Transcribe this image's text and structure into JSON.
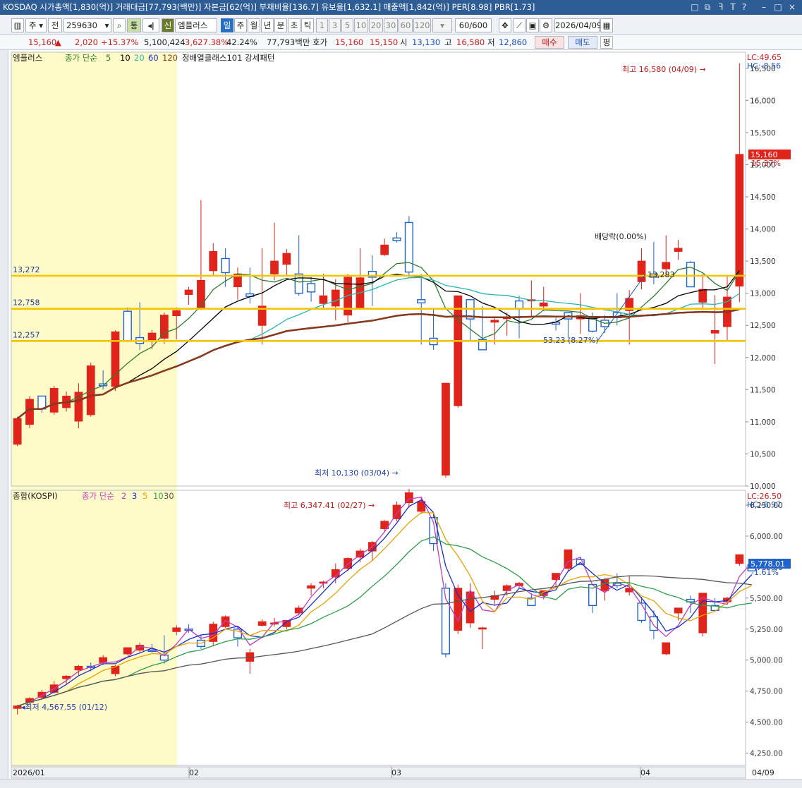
{
  "titlebar": {
    "text": "KOSDAQ 시가총액[1,830(억)] 거래대금[77,793(백만)] 자본금[62(억)] 부채비율[136.7] 유보율[1,632.1] 매출액[1,842(억)] PER[8.98] PBR[1.73]",
    "controls": [
      "□",
      "⧉",
      "ꟻ",
      "T",
      "?",
      "–",
      "□",
      "×"
    ]
  },
  "toolbar": {
    "market": "주",
    "prev": "전",
    "code": "259630",
    "tong": "통",
    "sin": "신",
    "name": "엠플러스",
    "periods": [
      "일",
      "주",
      "월",
      "년",
      "분",
      "초",
      "틱"
    ],
    "ticks": [
      "1",
      "3",
      "5",
      "10",
      "20",
      "30",
      "60",
      "120"
    ],
    "count": "60/600",
    "date": "2026/04/09"
  },
  "quote": {
    "price": "15,160",
    "up_arrow": "▲",
    "change": "2,020",
    "change_pct": "+15.37%",
    "volume": "5,100,424",
    "vol_ratio": "3,627.38%",
    "turnover": "42.24%",
    "amount": "77,793백만",
    "hoga_label": "호가",
    "ask": "15,160",
    "bid": "15,150",
    "open_label": "시",
    "open": "13,130",
    "high_label": "고",
    "high": "16,580",
    "low_label": "저",
    "low": "12,860",
    "buy": "매수",
    "sell": "매도",
    "flat": "평"
  },
  "upper_pane": {
    "legend_name": "엠플러스",
    "legend_ma": "종가 단순",
    "ma_periods": [
      "5",
      "10",
      "20",
      "60",
      "120"
    ],
    "ma_colors": [
      "#2e7d32",
      "#000000",
      "#26b5b5",
      "#1a2fd0",
      "#8b3a14"
    ],
    "pattern_label": "정배열클래스101 강세패턴",
    "lc": "LC:49.65",
    "hc": "HC:-8.56",
    "price_ticks": [
      "16,500",
      "16,000",
      "15,500",
      "15,000",
      "14,500",
      "14,000",
      "13,500",
      "13,000",
      "12,500",
      "12,000",
      "11,500",
      "11,000",
      "10,500",
      "10,000"
    ],
    "hlines": [
      "13,272",
      "12,758",
      "12,257"
    ],
    "current_price": "15,160",
    "current_pct": "15.37%",
    "high_note": "최고 16,580 (04/09)",
    "low_note": "최저 10,130 (03/04)",
    "dividend_note": "배당락(0.00%)",
    "measure_top": "13,283",
    "measure_note": "53.23 (8.27%)"
  },
  "lower_pane": {
    "legend_name": "종합(KOSPI)",
    "legend_ma": "종가 단순",
    "ma_periods": [
      "2",
      "3",
      "5",
      "10",
      "30"
    ],
    "ma_colors": [
      "#c23bc2",
      "#1a2fd0",
      "#e8a300",
      "#2e9e4e",
      "#555555"
    ],
    "lc": "LC:26.50",
    "hc": "HC:-8.97",
    "price_ticks": [
      "6,250.00",
      "6,000.00",
      "5,750.00",
      "5,500.00",
      "5,250.00",
      "5,000.00",
      "4,750.00",
      "4,500.00",
      "4,250.00"
    ],
    "current_price": "5,778.01",
    "current_pct": "-1.61%",
    "high_note": "최고 6,347.41 (02/27)",
    "low_note": "최저 4,567.55 (01/12)"
  },
  "x_axis": [
    "2026/01",
    "02",
    "03",
    "04"
  ],
  "x_axis_right": "04/09",
  "colors": {
    "up": "#e0241b",
    "down": "#1f63cc",
    "hline": "#f5c400",
    "highlight": "#fffbc8"
  },
  "chart_data": [
    {
      "type": "candlestick",
      "series_name": "엠플러스",
      "ylim": [
        10000,
        16750
      ],
      "dates_note": "2026/01 – 04/09",
      "candles": [
        [
          10650,
          11080,
          10620,
          11050
        ],
        [
          10960,
          11400,
          10900,
          11350
        ],
        [
          11400,
          11330,
          11140,
          11200
        ],
        [
          11150,
          11560,
          11110,
          11520
        ],
        [
          11220,
          11470,
          11160,
          11400
        ],
        [
          11010,
          11600,
          10900,
          11460
        ],
        [
          11110,
          11920,
          11080,
          11870
        ],
        [
          11590,
          11800,
          11500,
          11560
        ],
        [
          11550,
          12420,
          11480,
          12400
        ],
        [
          12720,
          12780,
          12240,
          12260
        ],
        [
          12310,
          12860,
          12120,
          12220
        ],
        [
          12250,
          12430,
          12130,
          12380
        ],
        [
          12300,
          12700,
          12210,
          12660
        ],
        [
          12650,
          12780,
          12280,
          12730
        ],
        [
          12980,
          13100,
          12820,
          13050
        ],
        [
          12750,
          14450,
          12740,
          13200
        ],
        [
          13350,
          13780,
          13270,
          13650
        ],
        [
          13540,
          13700,
          13100,
          13320
        ],
        [
          13100,
          13400,
          12900,
          13300
        ],
        [
          12990,
          13400,
          12840,
          12950
        ],
        [
          12500,
          13700,
          12200,
          12800
        ],
        [
          13300,
          14100,
          13200,
          13500
        ],
        [
          13450,
          13690,
          13270,
          13620
        ],
        [
          13300,
          13900,
          12960,
          13000
        ],
        [
          13150,
          13250,
          12870,
          13020
        ],
        [
          12840,
          13300,
          12760,
          12960
        ],
        [
          12800,
          13220,
          12580,
          13050
        ],
        [
          12660,
          13300,
          12550,
          13250
        ],
        [
          12750,
          13700,
          12820,
          13240
        ],
        [
          13340,
          13590,
          12800,
          13250
        ],
        [
          13600,
          13850,
          13580,
          13750
        ],
        [
          13860,
          13950,
          13790,
          13820
        ],
        [
          14100,
          14200,
          13250,
          13330
        ],
        [
          12900,
          13300,
          12200,
          12850
        ],
        [
          12300,
          12750,
          12120,
          12200
        ],
        [
          10170,
          10520,
          10130,
          11600
        ],
        [
          11250,
          12850,
          11220,
          12960
        ],
        [
          12900,
          12900,
          12250,
          12600
        ],
        [
          12280,
          12800,
          12120,
          12120
        ],
        [
          12550,
          12620,
          12200,
          12580
        ],
        [
          12620,
          12700,
          12340,
          12620
        ],
        [
          12880,
          12960,
          12300,
          12750
        ],
        [
          12880,
          13200,
          12630,
          12900
        ],
        [
          12800,
          13100,
          12720,
          12850
        ],
        [
          12550,
          12620,
          12420,
          12520
        ],
        [
          12700,
          12660,
          12300,
          12600
        ],
        [
          12600,
          13000,
          12370,
          12650
        ],
        [
          12620,
          12700,
          12390,
          12410
        ],
        [
          12580,
          12660,
          12380,
          12480
        ],
        [
          12700,
          13000,
          12500,
          12620
        ],
        [
          12730,
          13050,
          12200,
          12920
        ],
        [
          13180,
          13700,
          13060,
          13500
        ],
        [
          13300,
          13800,
          13140,
          13250
        ],
        [
          13380,
          13900,
          13260,
          13480
        ],
        [
          13650,
          13830,
          13520,
          13700
        ],
        [
          13480,
          13500,
          13170,
          13100
        ],
        [
          12860,
          13300,
          12750,
          13060
        ],
        [
          12380,
          12970,
          11900,
          12420
        ],
        [
          12480,
          13280,
          12260,
          12940
        ],
        [
          13110,
          16580,
          12860,
          15160
        ]
      ]
    },
    {
      "type": "candlestick",
      "series_name": "종합(KOSPI)",
      "ylim": [
        4150,
        6370
      ],
      "candles": [
        [
          4610,
          4640,
          4560,
          4630
        ],
        [
          4660,
          4700,
          4640,
          4690
        ],
        [
          4700,
          4760,
          4680,
          4740
        ],
        [
          4740,
          4830,
          4730,
          4800
        ],
        [
          4850,
          4880,
          4810,
          4870
        ],
        [
          4920,
          4960,
          4880,
          4950
        ],
        [
          4950,
          4980,
          4910,
          4940
        ],
        [
          4980,
          5040,
          4960,
          5020
        ],
        [
          4890,
          4960,
          4870,
          4950
        ],
        [
          5050,
          5100,
          5040,
          5100
        ],
        [
          5080,
          5140,
          5060,
          5120
        ],
        [
          5080,
          5130,
          5060,
          5070
        ],
        [
          5040,
          5200,
          4970,
          5000
        ],
        [
          5230,
          5280,
          5200,
          5260
        ],
        [
          5250,
          5290,
          5220,
          5240
        ],
        [
          5160,
          5200,
          5090,
          5110
        ],
        [
          5150,
          5310,
          5110,
          5290
        ],
        [
          5270,
          5360,
          5260,
          5350
        ],
        [
          5250,
          5270,
          5110,
          5180
        ],
        [
          4990,
          5090,
          4890,
          5060
        ],
        [
          5280,
          5330,
          5270,
          5310
        ],
        [
          5290,
          5340,
          5270,
          5300
        ],
        [
          5270,
          5320,
          5250,
          5320
        ],
        [
          5380,
          5440,
          5360,
          5420
        ],
        [
          5580,
          5620,
          5520,
          5600
        ],
        [
          5620,
          5640,
          5580,
          5630
        ],
        [
          5670,
          5780,
          5620,
          5730
        ],
        [
          5740,
          5830,
          5720,
          5820
        ],
        [
          5830,
          5900,
          5790,
          5880
        ],
        [
          5880,
          5960,
          5800,
          5950
        ],
        [
          6060,
          6130,
          6040,
          6120
        ],
        [
          6140,
          6280,
          6120,
          6250
        ],
        [
          6270,
          6380,
          6230,
          6350
        ],
        [
          6200,
          6320,
          6180,
          6280
        ],
        [
          6150,
          6180,
          5880,
          5940
        ],
        [
          5580,
          5620,
          5020,
          5050
        ],
        [
          5240,
          5610,
          5210,
          5580
        ],
        [
          5300,
          5620,
          5260,
          5550
        ],
        [
          5250,
          5270,
          5090,
          5260
        ],
        [
          5490,
          5560,
          5450,
          5520
        ],
        [
          5560,
          5610,
          5520,
          5600
        ],
        [
          5600,
          5630,
          5580,
          5620
        ],
        [
          5500,
          5540,
          5480,
          5440
        ],
        [
          5520,
          5550,
          5490,
          5560
        ],
        [
          5650,
          5700,
          5590,
          5700
        ],
        [
          5740,
          5880,
          5720,
          5890
        ],
        [
          5810,
          5830,
          5780,
          5770
        ],
        [
          5610,
          5600,
          5380,
          5440
        ],
        [
          5560,
          5660,
          5480,
          5650
        ],
        [
          5620,
          5700,
          5580,
          5600
        ],
        [
          5550,
          5680,
          5520,
          5580
        ],
        [
          5460,
          5510,
          5300,
          5320
        ],
        [
          5350,
          5400,
          5170,
          5240
        ],
        [
          5050,
          5110,
          5040,
          5140
        ],
        [
          5380,
          5410,
          5320,
          5420
        ],
        [
          5490,
          5520,
          5380,
          5470
        ],
        [
          5220,
          5480,
          5190,
          5540
        ],
        [
          5440,
          5500,
          5430,
          5400
        ],
        [
          5470,
          5510,
          5470,
          5500
        ],
        [
          5780,
          5840,
          5760,
          5850
        ],
        [
          5770,
          5810,
          5730,
          5720
        ]
      ]
    }
  ]
}
